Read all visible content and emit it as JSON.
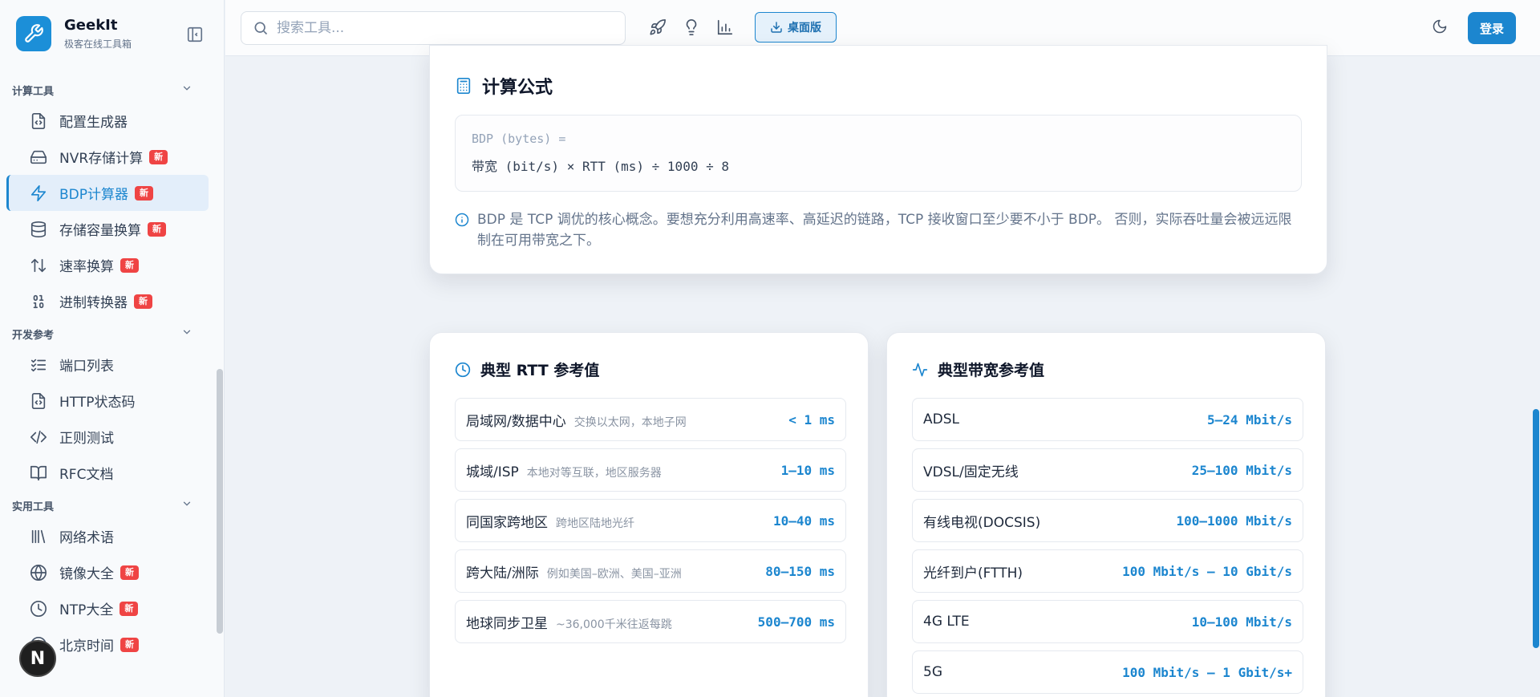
{
  "app": {
    "name": "GeekIt",
    "subtitle": "极客在线工具箱"
  },
  "colors": {
    "accent": "#1c86cf",
    "badge": "#ef4444"
  },
  "sidebar": {
    "groups": [
      {
        "title": "计算工具",
        "items": [
          {
            "label": "配置生成器",
            "icon": "file-code-icon",
            "badge": ""
          },
          {
            "label": "NVR存储计算",
            "icon": "hard-drive-icon",
            "badge": "新"
          },
          {
            "label": "BDP计算器",
            "icon": "lightning-icon",
            "badge": "新",
            "active": true
          },
          {
            "label": "存储容量换算",
            "icon": "database-icon",
            "badge": "新"
          },
          {
            "label": "速率换算",
            "icon": "arrows-updown-icon",
            "badge": "新"
          },
          {
            "label": "进制转换器",
            "icon": "binary-icon",
            "badge": "新"
          }
        ]
      },
      {
        "title": "开发参考",
        "items": [
          {
            "label": "端口列表",
            "icon": "list-check-icon",
            "badge": ""
          },
          {
            "label": "HTTP状态码",
            "icon": "file-code-icon",
            "badge": ""
          },
          {
            "label": "正则测试",
            "icon": "code-icon",
            "badge": ""
          },
          {
            "label": "RFC文档",
            "icon": "book-icon",
            "badge": ""
          }
        ]
      },
      {
        "title": "实用工具",
        "items": [
          {
            "label": "网络术语",
            "icon": "library-icon",
            "badge": ""
          },
          {
            "label": "镜像大全",
            "icon": "globe-icon",
            "badge": "新"
          },
          {
            "label": "NTP大全",
            "icon": "clock-icon",
            "badge": "新"
          },
          {
            "label": "北京时间",
            "icon": "clock-icon",
            "badge": "新"
          }
        ]
      }
    ],
    "avatar_letter": "N"
  },
  "header": {
    "search_placeholder": "搜索工具...",
    "desktop_label": "桌面版",
    "login_label": "登录"
  },
  "formula": {
    "title": "计算公式",
    "line1": "BDP (bytes) =",
    "line2": "带宽 (bit/s) × RTT (ms) ÷ 1000 ÷ 8",
    "note": "BDP 是 TCP 调优的核心概念。要想充分利用高速率、高延迟的链路，TCP 接收窗口至少要不小于 BDP。 否则，实际吞吐量会被远远限制在可用带宽之下。"
  },
  "rtt": {
    "title": "典型 RTT 参考值",
    "rows": [
      {
        "name": "局域网/数据中心",
        "desc": "交换以太网，本地子网",
        "value": "< 1 ms"
      },
      {
        "name": "城域/ISP",
        "desc": "本地对等互联，地区服务器",
        "value": "1–10 ms"
      },
      {
        "name": "同国家跨地区",
        "desc": "跨地区陆地光纤",
        "value": "10–40 ms"
      },
      {
        "name": "跨大陆/洲际",
        "desc": "例如美国–欧洲、美国–亚洲",
        "value": "80–150 ms"
      },
      {
        "name": "地球同步卫星",
        "desc": "~36,000千米往返每跳",
        "value": "500–700 ms"
      }
    ]
  },
  "bandwidth": {
    "title": "典型带宽参考值",
    "rows": [
      {
        "name": "ADSL",
        "value": "5–24 Mbit/s"
      },
      {
        "name": "VDSL/固定无线",
        "value": "25–100 Mbit/s"
      },
      {
        "name": "有线电视(DOCSIS)",
        "value": "100–1000 Mbit/s"
      },
      {
        "name": "光纤到户(FTTH)",
        "value": "100 Mbit/s – 10 Gbit/s"
      },
      {
        "name": "4G LTE",
        "value": "10–100 Mbit/s"
      },
      {
        "name": "5G",
        "value": "100 Mbit/s – 1 Gbit/s+"
      }
    ]
  }
}
